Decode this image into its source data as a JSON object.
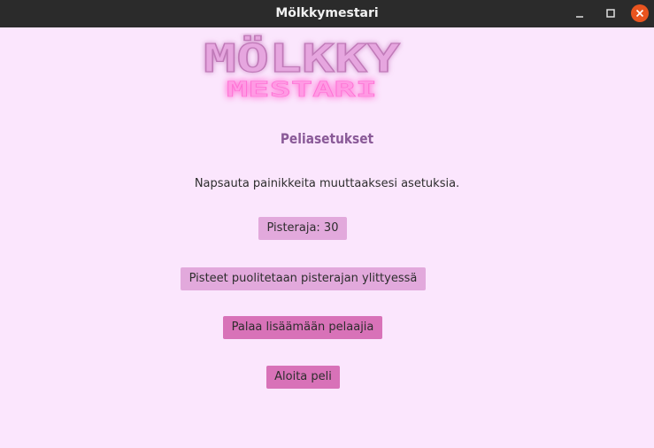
{
  "window": {
    "title": "Mölkkymestari",
    "controls": [
      "minimize-icon",
      "maximize-icon",
      "close-icon"
    ],
    "close_color": "#e9541f"
  },
  "logo": {
    "line1": "MÖLKKY",
    "line2": "MESTARI",
    "colors": {
      "line1": "#e6a6df",
      "line2": "#ff8fe0"
    }
  },
  "main": {
    "heading": "Peliasetukset",
    "instruction": "Napsauta painikkeita muuttaaksesi asetuksia.",
    "buttons": {
      "score_limit": "Pisteraja: 30",
      "halving_rule": "Pisteet puolitetaan pisterajan ylittyessä",
      "back_to_players": "Palaa lisäämään pelaajia",
      "start_game": "Aloita peli"
    }
  },
  "colors": {
    "background": "#fbe6fd",
    "heading": "#8a5a98",
    "button_light": "#e2a9dc",
    "button_dark": "#d872b8"
  }
}
